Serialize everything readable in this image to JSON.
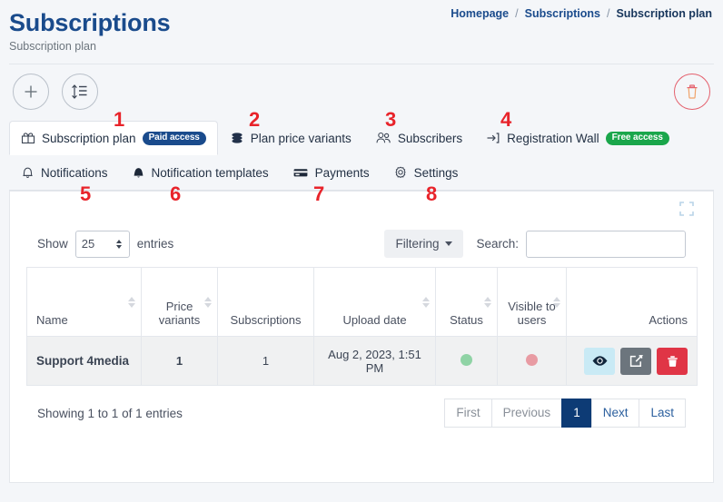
{
  "header": {
    "title": "Subscriptions",
    "subtitle": "Subscription plan",
    "breadcrumb": [
      {
        "label": "Homepage"
      },
      {
        "label": "Subscriptions"
      },
      {
        "label": "Subscription plan"
      }
    ],
    "separator": "/"
  },
  "toolbar": {
    "add_label": "add-icon",
    "reorder_label": "reorder-icon",
    "delete_label": "delete-icon"
  },
  "tabs": {
    "row1": [
      {
        "number": "1",
        "label": "Subscription plan",
        "icon": "box-open-icon",
        "badge": "Paid access",
        "badge_type": "paid",
        "active": true
      },
      {
        "number": "2",
        "label": "Plan price variants",
        "icon": "coins-icon",
        "badge": "",
        "badge_type": "",
        "active": false
      },
      {
        "number": "3",
        "label": "Subscribers",
        "icon": "users-icon",
        "badge": "",
        "badge_type": "",
        "active": false
      },
      {
        "number": "4",
        "label": "Registration Wall",
        "icon": "sign-in-icon",
        "badge": "Free access",
        "badge_type": "free",
        "active": false
      }
    ],
    "row2": [
      {
        "number": "5",
        "label": "Notifications",
        "icon": "bell-outline-icon",
        "active": false
      },
      {
        "number": "6",
        "label": "Notification templates",
        "icon": "bell-filled-icon",
        "active": false
      },
      {
        "number": "7",
        "label": "Payments",
        "icon": "credit-card-icon",
        "active": false
      },
      {
        "number": "8",
        "label": "Settings",
        "icon": "gear-icon",
        "active": false
      }
    ]
  },
  "datatable": {
    "show_label": "Show",
    "entries_label": "entries",
    "page_length": "25",
    "filtering_label": "Filtering",
    "search_label": "Search:",
    "search_value": "",
    "search_placeholder": "",
    "columns": [
      {
        "label": "Name",
        "sortable": true
      },
      {
        "label": "Price variants",
        "sortable": true
      },
      {
        "label": "Subscriptions",
        "sortable": false
      },
      {
        "label": "Upload date",
        "sortable": true
      },
      {
        "label": "Status",
        "sortable": true
      },
      {
        "label": "Visible to users",
        "sortable": true
      },
      {
        "label": "Actions",
        "sortable": false
      }
    ],
    "rows": [
      {
        "name": "Support 4media",
        "price_variants": "1",
        "subscriptions": "1",
        "upload_date": "Aug 2, 2023, 1:51 PM",
        "status": "active",
        "status_color": "#8fd3a5",
        "visible": "inactive",
        "visible_color": "#e89ba3",
        "actions": [
          "eye-icon",
          "edit-icon",
          "trash-icon"
        ]
      }
    ],
    "info": "Showing 1 to 1 of 1 entries",
    "pagination": [
      {
        "label": "First",
        "active": false
      },
      {
        "label": "Previous",
        "active": false
      },
      {
        "label": "1",
        "active": true
      },
      {
        "label": "Next",
        "active": false
      },
      {
        "label": "Last",
        "active": false
      }
    ]
  }
}
